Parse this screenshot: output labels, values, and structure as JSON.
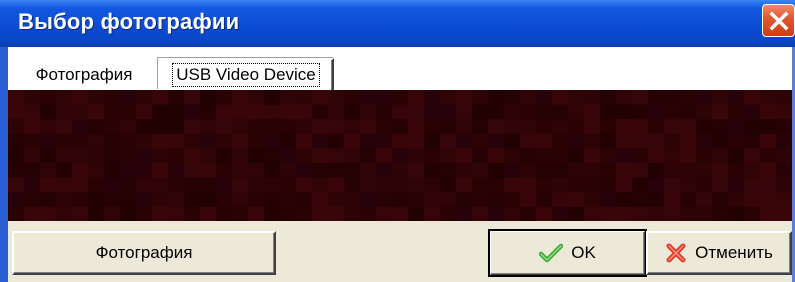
{
  "window": {
    "title": "Выбор фотографии",
    "close_icon": "close-icon"
  },
  "tabs": [
    {
      "label": "Фотография",
      "selected": false
    },
    {
      "label": "USB Video Device",
      "selected": true
    }
  ],
  "preview": {
    "icon": "video-preview",
    "dominant_color": "#2a0204"
  },
  "buttons": {
    "photo_label": "Фотография",
    "ok_label": "OK",
    "ok_icon": "checkmark-icon",
    "cancel_label": "Отменить",
    "cancel_icon": "cross-icon"
  },
  "colors": {
    "titlebar": "#0a4ad1",
    "close": "#d03c12",
    "face": "#ece9d8"
  }
}
